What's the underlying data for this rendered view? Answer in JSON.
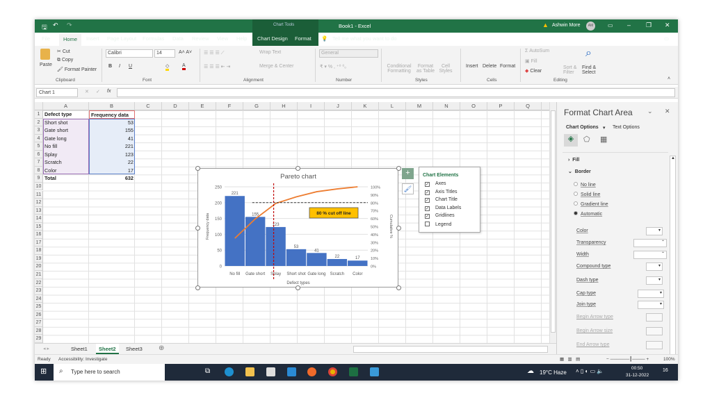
{
  "titlebar": {
    "context_tab": "Chart Tools",
    "title": "Book1 - Excel",
    "user": "Ashwin More",
    "initials": "AM"
  },
  "tabs": [
    "File",
    "Home",
    "Insert",
    "Page Layout",
    "Formulas",
    "Data",
    "Review",
    "View",
    "Help",
    "Chart Design",
    "Format"
  ],
  "tell_me": "Tell me what you want to do",
  "ribbon": {
    "clipboard": {
      "paste": "Paste",
      "cut": "Cut",
      "copy": "Copy",
      "format_painter": "Format Painter",
      "label": "Clipboard"
    },
    "font": {
      "name": "Calibri",
      "size": "14",
      "bold": "B",
      "italic": "I",
      "underline": "U",
      "label": "Font"
    },
    "alignment": {
      "wrap": "Wrap Text",
      "merge": "Merge & Center",
      "label": "Alignment"
    },
    "number": {
      "format": "General",
      "label": "Number"
    },
    "styles": {
      "conditional": "Conditional Formatting",
      "format_table": "Format as Table",
      "cell_styles": "Cell Styles",
      "label": "Styles"
    },
    "cells": {
      "insert": "Insert",
      "delete": "Delete",
      "format": "Format",
      "label": "Cells"
    },
    "editing": {
      "autosum": "AutoSum",
      "fill": "Fill",
      "clear": "Clear",
      "sort": "Sort & Filter",
      "find": "Find & Select",
      "label": "Editing"
    }
  },
  "formula_bar": {
    "name_box": "Chart 1",
    "fx": "fx",
    "value": ""
  },
  "columns": [
    "A",
    "B",
    "C",
    "D",
    "E",
    "F",
    "G",
    "H",
    "I",
    "J",
    "K",
    "L",
    "M",
    "N",
    "O",
    "P",
    "Q",
    "R"
  ],
  "sheet_cells": {
    "header": [
      "Defect type",
      "Frequency data"
    ],
    "rows": [
      [
        "Short shot",
        "53"
      ],
      [
        "Gate short",
        "155"
      ],
      [
        "Gate long",
        "41"
      ],
      [
        "No fill",
        "221"
      ],
      [
        "Splay",
        "123"
      ],
      [
        "Scratch",
        "22"
      ],
      [
        "Color",
        "17"
      ]
    ],
    "total": [
      "Total",
      "632"
    ]
  },
  "chart_data": {
    "type": "bar",
    "title": "Pareto chart",
    "xlabel": "Defect types",
    "ylabel": "Frequency data",
    "y2label": "Cumulative %",
    "categories": [
      "No fill",
      "Gate short",
      "Splay",
      "Short shot",
      "Gate long",
      "Scratch",
      "Color"
    ],
    "values": [
      221,
      155,
      123,
      53,
      41,
      22,
      17
    ],
    "cumulative_percent": [
      35.0,
      59.5,
      79.0,
      87.3,
      93.8,
      97.3,
      100
    ],
    "ylim": [
      0,
      250
    ],
    "yticks": [
      "0",
      "50",
      "100",
      "150",
      "200",
      "250"
    ],
    "y2lim": [
      0,
      100
    ],
    "y2ticks": [
      "0%",
      "10%",
      "20%",
      "30%",
      "40%",
      "50%",
      "60%",
      "70%",
      "80%",
      "90%",
      "100%"
    ],
    "cutoff_percent": 80,
    "annotation": "80 % cut off line",
    "bar_color": "#4472c4",
    "line_color": "#ed7d31",
    "cutoff_color": "#c00000",
    "annotation_bg": "#ffc000",
    "grid": true,
    "legend": false
  },
  "chart_elements": {
    "title": "Chart Elements",
    "items": [
      {
        "label": "Axes",
        "checked": true
      },
      {
        "label": "Axis Titles",
        "checked": true
      },
      {
        "label": "Chart Title",
        "checked": true
      },
      {
        "label": "Data Labels",
        "checked": true
      },
      {
        "label": "Gridlines",
        "checked": true
      },
      {
        "label": "Legend",
        "checked": false
      }
    ]
  },
  "pane": {
    "title": "Format Chart Area",
    "chart_options": "Chart Options",
    "text_options": "Text Options",
    "fill": "Fill",
    "border": "Border",
    "radios": [
      {
        "label": "No line",
        "selected": false
      },
      {
        "label": "Solid line",
        "selected": false
      },
      {
        "label": "Gradient line",
        "selected": false
      },
      {
        "label": "Automatic",
        "selected": true
      }
    ],
    "props": [
      "Color",
      "Transparency",
      "Width",
      "Compound type",
      "Dash type",
      "Cap type",
      "Join type"
    ],
    "disabled_props": [
      "Begin Arrow type",
      "Begin Arrow size",
      "End Arrow type"
    ]
  },
  "sheets": [
    "Sheet1",
    "Sheet2",
    "Sheet3"
  ],
  "active_sheet": "Sheet2",
  "status": {
    "ready": "Ready",
    "accessibility": "Accessibility: Investigate",
    "zoom": "100%"
  },
  "taskbar": {
    "search": "Type here to search",
    "weather": "19°C Haze",
    "time": "00:50",
    "date": "31-12-2022",
    "notif": "16"
  }
}
